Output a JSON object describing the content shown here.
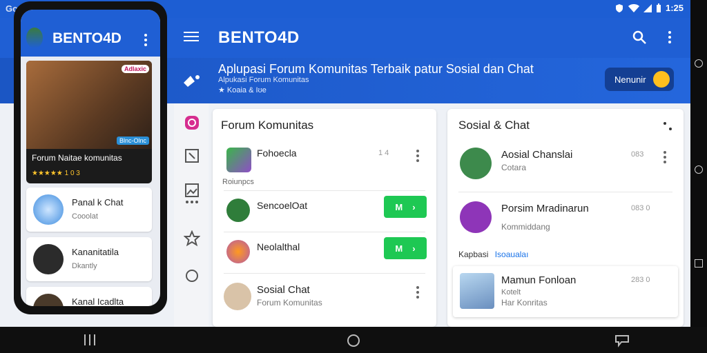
{
  "status": {
    "left": "Gc",
    "right": "1:25"
  },
  "app": {
    "title": "BENTO4D"
  },
  "banner": {
    "headline": "Aplupasi Forum Komunitas Terbaik patur Sosial dan Chat",
    "subline": "Alpukasi Forum Komunitas",
    "rating": "★ Koaia & Iʊe",
    "pill_label": "Nenunir"
  },
  "forum": {
    "title": "Forum Komunitas",
    "section_label": "Roiunpcs",
    "rows": [
      {
        "name": "Fohoecla",
        "sub": "",
        "meta": "1 4"
      },
      {
        "name": "SencoelOat",
        "sub": "",
        "button": "M"
      },
      {
        "name": "Neolalthal",
        "sub": "",
        "button": "M"
      },
      {
        "name": "Sosial Chat",
        "sub": "Forum Komunitas"
      }
    ]
  },
  "social": {
    "title": "Sosial & Chat",
    "section_label": "Kapbasi",
    "section_link": "Isoaualaı",
    "rows": [
      {
        "name": "Aosial Chanslai",
        "sub": "Cotara",
        "meta": "083"
      },
      {
        "name": "Porsim Mradinarun",
        "sub": "Kommiddang",
        "meta": "083  0"
      },
      {
        "name": "Mamun Fonloan",
        "sub": "Kotelt",
        "sub2": "Har Konritas",
        "meta": "283  0"
      }
    ]
  },
  "phone": {
    "title": "BENTO4D",
    "hero_caption": "Forum Naitae komunitas",
    "hero_stars": "★★★★★ 1 0 3",
    "hero_badge": "Adlaxic",
    "hero_badge2": "Blnc-Olnc",
    "cards": [
      {
        "name": "Panal k Chat",
        "sub": "Cooolat"
      },
      {
        "name": "Kananitatila",
        "sub": "Dkantly"
      },
      {
        "name": "Kanal Icadlta",
        "sub": ""
      }
    ]
  },
  "colors": {
    "primary": "#1f5fd4",
    "accent_green": "#1ec853",
    "accent_yellow": "#ffbf1e"
  }
}
